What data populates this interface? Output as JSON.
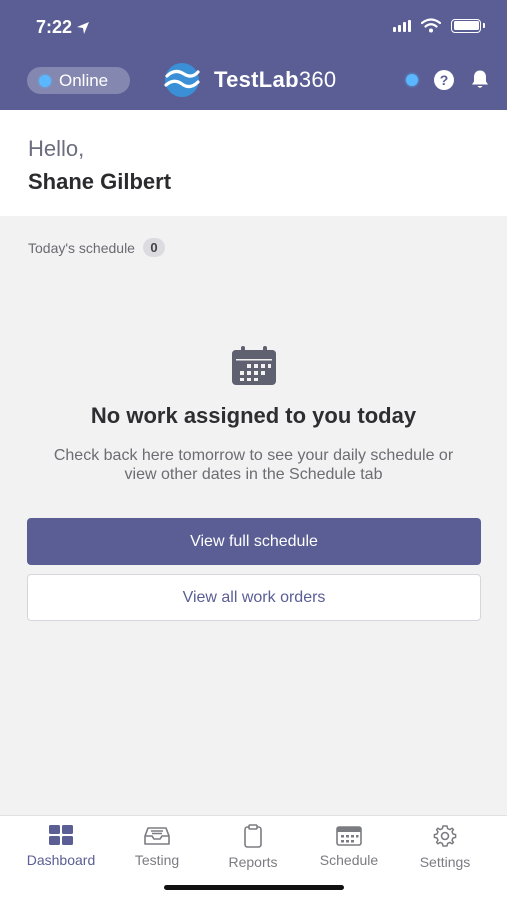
{
  "status_bar": {
    "time": "7:22"
  },
  "header": {
    "connection_status": "Online",
    "brand_name": "TestLab",
    "brand_number": "360",
    "help_glyph": "?",
    "accent_color": "#5a5e94",
    "status_dot_color": "#5bb7ff"
  },
  "greeting": {
    "hello": "Hello,",
    "user_name": "Shane Gilbert"
  },
  "schedule": {
    "label": "Today's schedule",
    "count": "0"
  },
  "empty_state": {
    "icon": "calendar-icon",
    "title": "No work assigned to you today",
    "description": "Check back here tomorrow to see your daily schedule or view other dates in the Schedule tab"
  },
  "actions": {
    "view_schedule_label": "View full schedule",
    "view_work_orders_label": "View all work orders"
  },
  "tabs": [
    {
      "label": "Dashboard",
      "icon": "dashboard-icon",
      "active": true
    },
    {
      "label": "Testing",
      "icon": "inbox-tray-icon",
      "active": false
    },
    {
      "label": "Reports",
      "icon": "clipboard-icon",
      "active": false
    },
    {
      "label": "Schedule",
      "icon": "calendar-icon",
      "active": false
    },
    {
      "label": "Settings",
      "icon": "gear-icon",
      "active": false
    }
  ]
}
